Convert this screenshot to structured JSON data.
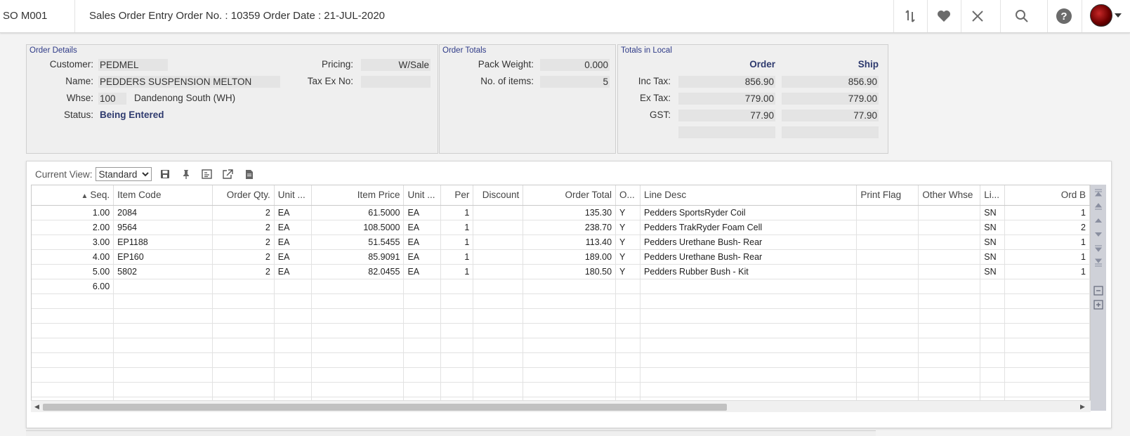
{
  "header": {
    "code": "SO M001",
    "title": "Sales Order Entry Order No. : 10359 Order Date : 21-JUL-2020"
  },
  "order_details": {
    "title": "Order Details",
    "customer_label": "Customer:",
    "customer_value": "PEDMEL",
    "name_label": "Name:",
    "name_value": "PEDDERS SUSPENSION MELTON",
    "whse_label": "Whse:",
    "whse_code": "100",
    "whse_name": "Dandenong South (WH)",
    "status_label": "Status:",
    "status_value": "Being Entered",
    "pricing_label": "Pricing:",
    "pricing_value": "W/Sale",
    "taxex_label": "Tax Ex No:",
    "taxex_value": ""
  },
  "order_totals": {
    "title": "Order Totals",
    "pack_weight_label": "Pack Weight:",
    "pack_weight_value": "0.000",
    "items_label": "No. of items:",
    "items_value": "5"
  },
  "totals_local": {
    "title": "Totals in Local",
    "col_order": "Order",
    "col_ship": "Ship",
    "inc_tax_label": "Inc Tax:",
    "inc_tax_order": "856.90",
    "inc_tax_ship": "856.90",
    "ex_tax_label": "Ex Tax:",
    "ex_tax_order": "779.00",
    "ex_tax_ship": "779.00",
    "gst_label": "GST:",
    "gst_order": "77.90",
    "gst_ship": "77.90"
  },
  "view": {
    "label": "Current View:",
    "selected": "Standard"
  },
  "grid": {
    "columns": [
      "Seq.",
      "Item Code",
      "Order Qty.",
      "Unit ...",
      "Item Price",
      "Unit ...",
      "Per",
      "Discount",
      "Order Total",
      "O...",
      "Line Desc",
      "Print Flag",
      "Other Whse",
      "Li...",
      "Ord B"
    ],
    "rows": [
      [
        "1.00",
        "2084",
        "2",
        "EA",
        "61.5000",
        "EA",
        "1",
        "",
        "135.30",
        "Y",
        "Pedders SportsRyder Coil",
        "",
        "",
        "SN",
        "1"
      ],
      [
        "2.00",
        "9564",
        "2",
        "EA",
        "108.5000",
        "EA",
        "1",
        "",
        "238.70",
        "Y",
        "Pedders TrakRyder Foam Cell",
        "",
        "",
        "SN",
        "2"
      ],
      [
        "3.00",
        "EP1188",
        "2",
        "EA",
        "51.5455",
        "EA",
        "1",
        "",
        "113.40",
        "Y",
        "Pedders Urethane Bush- Rear",
        "",
        "",
        "SN",
        "1"
      ],
      [
        "4.00",
        "EP160",
        "2",
        "EA",
        "85.9091",
        "EA",
        "1",
        "",
        "189.00",
        "Y",
        "Pedders Urethane Bush- Rear",
        "",
        "",
        "SN",
        "1"
      ],
      [
        "5.00",
        "5802",
        "2",
        "EA",
        "82.0455",
        "EA",
        "1",
        "",
        "180.50",
        "Y",
        "Pedders Rubber Bush - Kit",
        "",
        "",
        "SN",
        "1"
      ],
      [
        "6.00",
        "",
        "",
        "",
        "",
        "",
        "",
        "",
        "",
        "",
        "",
        "",
        "",
        "",
        ""
      ]
    ],
    "empty_rows": 8
  },
  "icons": [
    "sort-icon",
    "favorite-icon",
    "close-icon",
    "search-icon",
    "help-icon",
    "save-view-icon",
    "pin-icon",
    "export-icon",
    "open-external-icon",
    "document-icon",
    "magnifier-icon",
    "scroll-top-icon",
    "page-up-icon",
    "row-up-icon",
    "row-down-icon",
    "page-down-icon",
    "scroll-bottom-icon",
    "collapse-icon",
    "expand-icon"
  ],
  "colors": {
    "accent": "#2e3a6e",
    "panel_bg": "#efefef",
    "field_bg": "#e4e4e4"
  }
}
